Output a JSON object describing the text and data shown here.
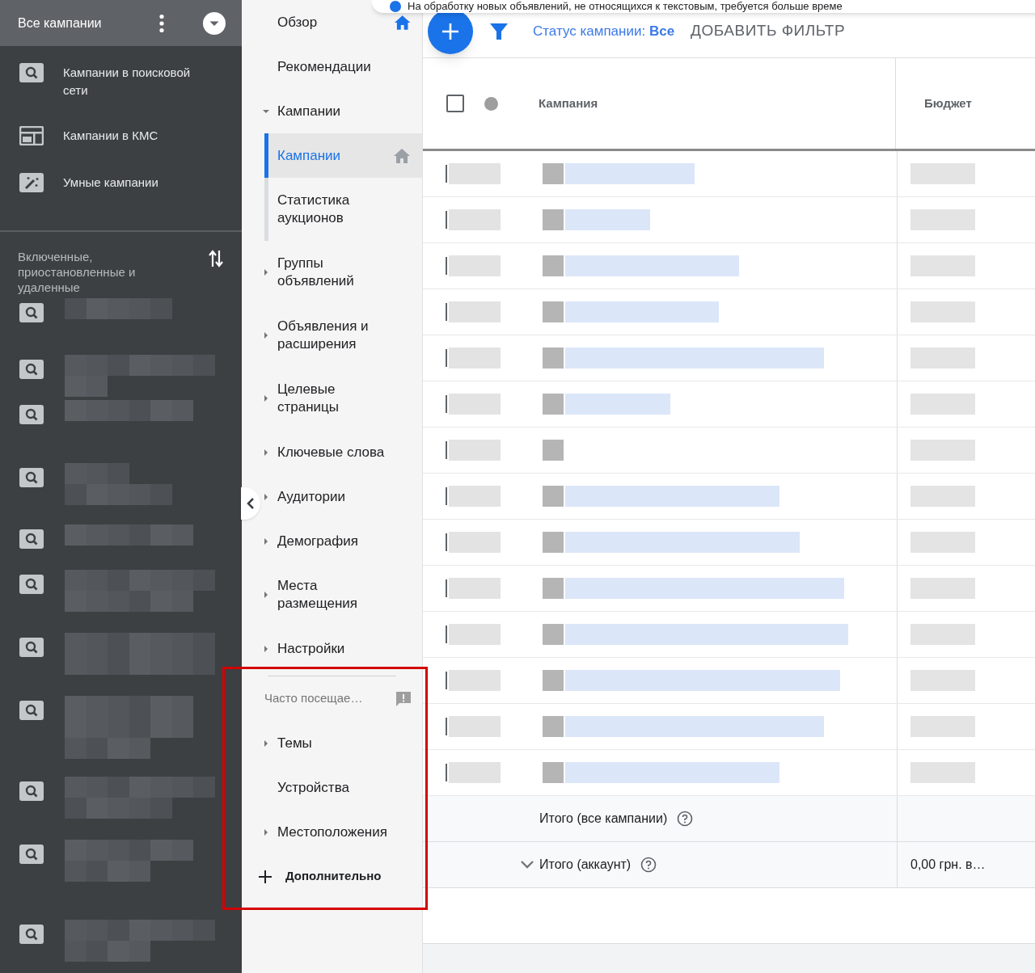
{
  "account_menu": {
    "title": "Все кампании"
  },
  "campaign_types": [
    {
      "label": "Кампании в поисковой сети",
      "kind": "search"
    },
    {
      "label": "Кампании в КМС",
      "kind": "display"
    },
    {
      "label": "Умные кампании",
      "kind": "smart"
    }
  ],
  "status_filter": {
    "label": "Включенные, приостановленные и удаленные"
  },
  "notification": {
    "text": "На обработку новых объявлений, не относящихся к текстовым, требуется больше време"
  },
  "nav": [
    {
      "label": "Обзор",
      "expandable": false,
      "home_icon": true,
      "home_page": true
    },
    {
      "label": "Рекомендации",
      "expandable": false
    },
    {
      "label": "Кампании",
      "expandable": true,
      "expanded": true,
      "children": [
        {
          "label": "Кампании",
          "selected": true,
          "home_icon": true,
          "home_page": false
        },
        {
          "label": "Статистика аукционов",
          "selected": false
        }
      ]
    },
    {
      "label": "Группы объявлений",
      "expandable": true,
      "expanded": false
    },
    {
      "label": "Объявления и расширения",
      "expandable": true,
      "expanded": false
    },
    {
      "label": "Целевые страницы",
      "expandable": true,
      "expanded": false
    },
    {
      "label": "Ключевые слова",
      "expandable": true,
      "expanded": false
    },
    {
      "label": "Аудитории",
      "expandable": true,
      "expanded": false
    },
    {
      "label": "Демография",
      "expandable": true,
      "expanded": false
    },
    {
      "label": "Места размещения",
      "expandable": true,
      "expanded": false
    },
    {
      "label": "Настройки",
      "expandable": true,
      "expanded": false
    }
  ],
  "frequent": {
    "title": "Часто посещае…",
    "items": [
      {
        "label": "Темы",
        "expandable": true
      },
      {
        "label": "Устройства",
        "expandable": false
      },
      {
        "label": "Местоположения",
        "expandable": true
      }
    ]
  },
  "more_button": {
    "label": "Дополнительно"
  },
  "toolbar": {
    "status_filter": "Статус кампании: **Все**",
    "add_filter": "ДОБАВИТЬ ФИЛЬТР"
  },
  "table": {
    "header_checked": false,
    "columns": [
      "Кампания",
      "Бюджет"
    ],
    "totals": [
      {
        "label": "Итого (все кампании)",
        "expandable": false
      },
      {
        "label": "Итого (аккаунт)",
        "expandable": true,
        "budget": "0,00 грн. в…"
      }
    ]
  }
}
